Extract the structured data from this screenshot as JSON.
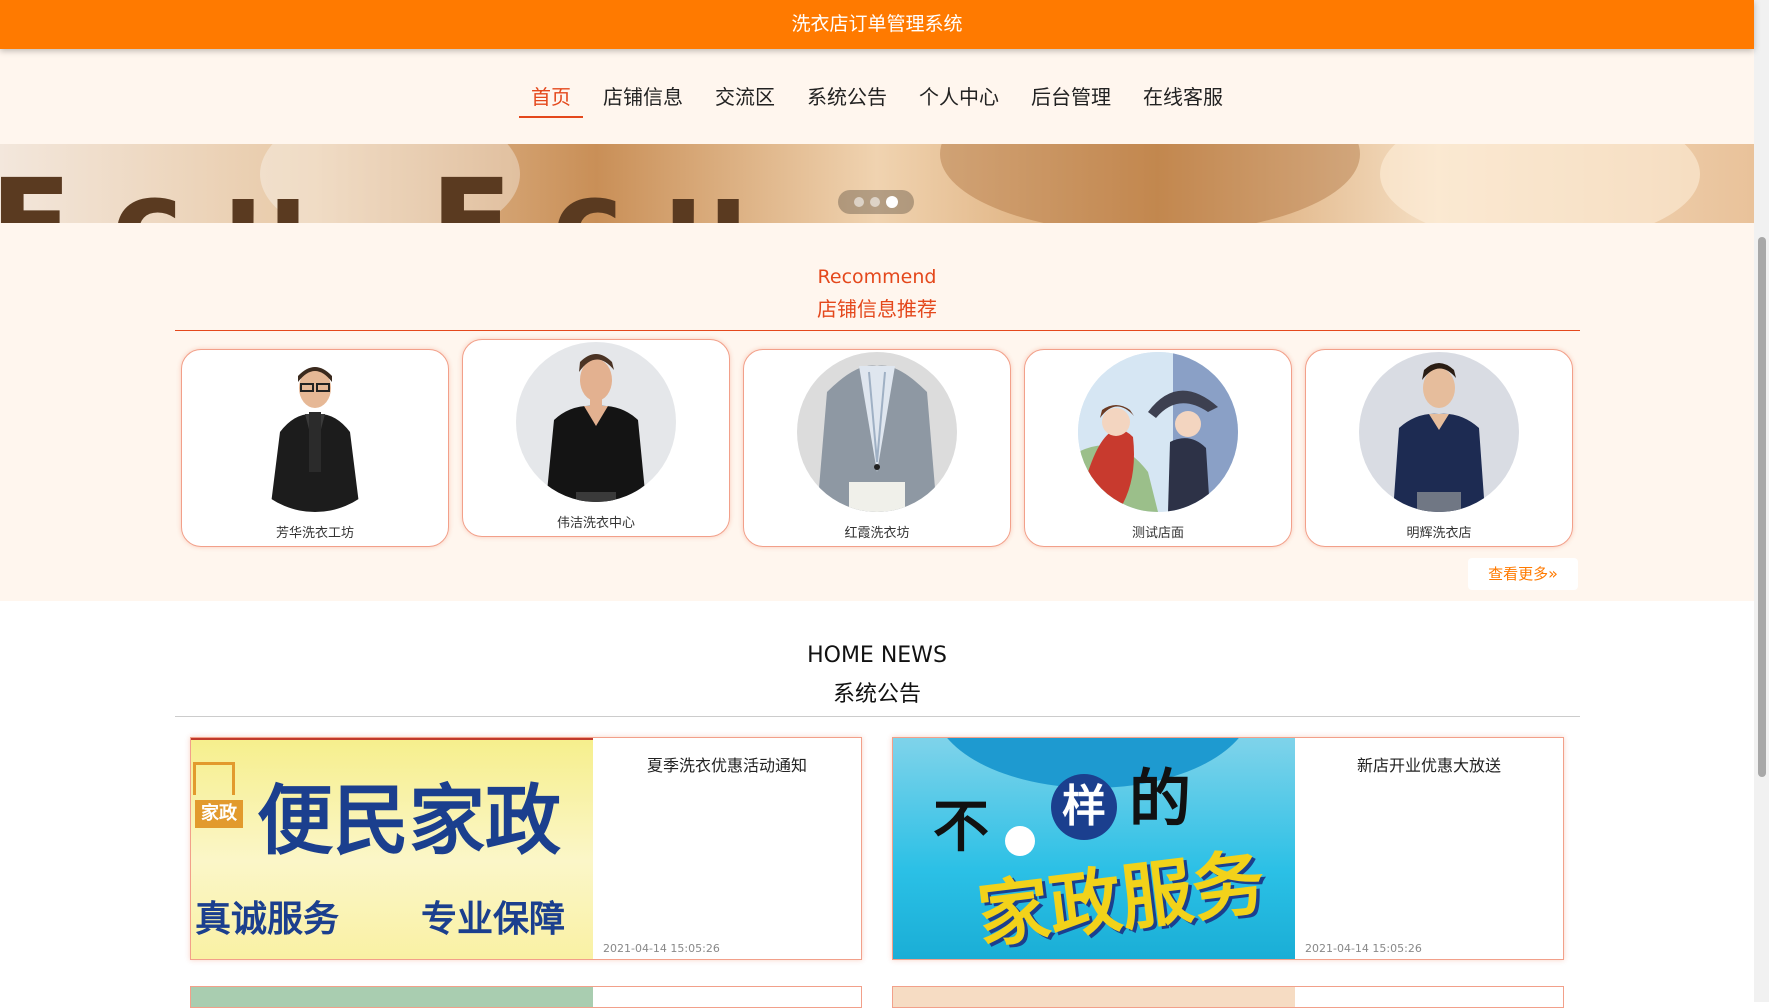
{
  "header": {
    "title": "洗衣店订单管理系统"
  },
  "nav": {
    "items": [
      {
        "label": "首页",
        "active": true
      },
      {
        "label": "店铺信息"
      },
      {
        "label": "交流区"
      },
      {
        "label": "系统公告"
      },
      {
        "label": "个人中心"
      },
      {
        "label": "后台管理"
      },
      {
        "label": "在线客服"
      }
    ]
  },
  "banner": {
    "slide_count": 3,
    "active_slide": 2,
    "overlay_text": "Fcu Fcu"
  },
  "recommend": {
    "title_en": "Recommend",
    "title_cn": "店铺信息推荐",
    "shops": [
      {
        "name": "芳华洗衣工坊"
      },
      {
        "name": "伟洁洗衣中心"
      },
      {
        "name": "红霞洗衣坊"
      },
      {
        "name": "测试店面"
      },
      {
        "name": "明辉洗衣店"
      }
    ],
    "more_label": "查看更多",
    "more_icon": "double-chevron-right-icon"
  },
  "news": {
    "title_en": "HOME NEWS",
    "title_cn": "系统公告",
    "items": [
      {
        "title": "夏季洗衣优惠活动通知",
        "date": "2021-04-14 15:05:26",
        "image_text": {
          "badge": "家政",
          "main": "便民家政",
          "sub1": "真诚服务",
          "sub2": "专业保障"
        }
      },
      {
        "title": "新店开业优惠大放送",
        "date": "2021-04-14 15:05:26",
        "image_text": {
          "top_a": "不",
          "top_b": "样",
          "top_c": "的",
          "main": "家政服务"
        }
      }
    ]
  },
  "colors": {
    "brand_orange": "#ff7a00",
    "accent_red": "#e4481c",
    "section_bg": "#fff6ee"
  }
}
